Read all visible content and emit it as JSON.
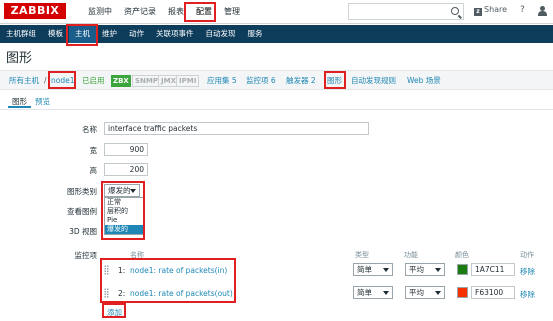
{
  "app": {
    "logo": "ZABBIX",
    "top_menu": [
      "监测中",
      "资产记录",
      "报表",
      "配置",
      "管理"
    ],
    "active_top": "配置",
    "share_label": "Share",
    "help_label": "?"
  },
  "sub_menu": {
    "items": [
      "主机群组",
      "模板",
      "主机",
      "维护",
      "动作",
      "关联项事件",
      "自动发现",
      "服务"
    ],
    "active": "主机"
  },
  "page": {
    "title": "图形"
  },
  "host_nav": {
    "all_hosts": "所有主机",
    "sep": "/",
    "host": "node1",
    "status": "已启用",
    "zbx": "ZBX",
    "snmp": "SNMP",
    "jmx": "JMX",
    "ipmi": "IPMI",
    "applications": "应用集 5",
    "items": "监控项 6",
    "triggers": "触发器 2",
    "graphs": "图形",
    "discovery": "自动发现规则",
    "web": "Web 场景"
  },
  "tabs": [
    "图形",
    "预览"
  ],
  "form": {
    "name_label": "名称",
    "name_value": "interface traffic packets",
    "width_label": "宽",
    "width_value": "900",
    "height_label": "高",
    "height_value": "200",
    "type_label": "图形类别",
    "type_value": "爆发的",
    "type_options": [
      "正常",
      "层积的",
      "Pie",
      "爆发的"
    ],
    "legend_label": "查看图例",
    "view3d_label": "3D 视图",
    "items_label": "监控项",
    "columns": {
      "name": "名称",
      "type": "类型",
      "function": "功能",
      "color": "颜色",
      "action": "动作"
    },
    "items": [
      {
        "index": "1:",
        "name": "node1: rate of packets(in)",
        "type": "简单",
        "function": "平均",
        "color": "1A7C11",
        "action": "移除"
      },
      {
        "index": "2:",
        "name": "node1: rate of packets(out)",
        "type": "简单",
        "function": "平均",
        "color": "F63100",
        "action": "移除"
      }
    ],
    "add_label": "添加"
  },
  "colors": {
    "logo_red": "#d40000",
    "subbar_bg": "#0e3d5c",
    "link_blue": "#1e87b5",
    "highlight_red": "#e02020",
    "item1_color": "#1A7C11",
    "item2_color": "#F63100"
  }
}
